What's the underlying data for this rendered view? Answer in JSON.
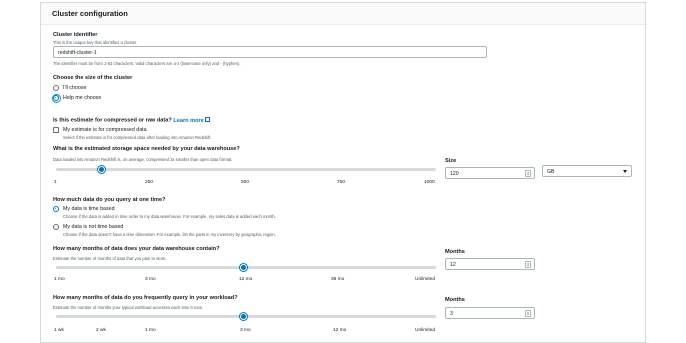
{
  "panel": {
    "title": "Cluster configuration"
  },
  "identifier": {
    "label": "Cluster identifier",
    "description": "This is the unique key that identifies a cluster.",
    "value": "redshift-cluster-1",
    "constraint": "The identifier must be from 1-63 characters. Valid characters are a-z (lowercase only) and - (hyphen)."
  },
  "size_choice": {
    "label": "Choose the size of the cluster",
    "options": [
      {
        "label": "I'll choose",
        "selected": false
      },
      {
        "label": "Help me choose",
        "selected": true
      }
    ]
  },
  "compressed": {
    "question": "Is this estimate for compressed or raw data?",
    "learn_more": "Learn more",
    "checkbox_label": "My estimate is for compressed data",
    "checkbox_desc": "Select if the estimate is for compressed data after loading into Amazon Redshift.",
    "checked": false
  },
  "storage": {
    "question": "What is the estimated storage space needed by your data warehouse?",
    "description": "Data loaded into Amazon Redshift is, on average, compressed 3x smaller than open data format.",
    "ticks": [
      "1",
      "250",
      "500",
      "750",
      "1000"
    ],
    "slider_value": 120,
    "slider_min": 1,
    "slider_max": 1000,
    "size_label": "Size",
    "size_value": "120",
    "unit_value": "GB"
  },
  "query_frequency": {
    "question": "How much data do you query at one time?",
    "options": [
      {
        "label": "My data is time based",
        "desc": "Choose if the data is added in time order to my data warehouse. For example, my sales data is added each month.",
        "selected": true
      },
      {
        "label": "My data is not time based",
        "desc": "Choose if the data doesn't have a time dimension. For example, list the parts in my inventory by geographic region.",
        "selected": false
      }
    ]
  },
  "months_contain": {
    "question": "How many months of data does your data warehouse contain?",
    "description": "Estimate the number of months of data that you plan to store.",
    "ticks": [
      "1 mo",
      "3 mo",
      "12 mo",
      "36 mo",
      "Unlimited"
    ],
    "slider_fraction": 0.5,
    "field_label": "Months",
    "field_value": "12"
  },
  "months_query": {
    "question": "How many months of data do you frequently query in your workload?",
    "description": "Estimate the number of months your typical workload accesses each time it runs.",
    "ticks": [
      "1 wk",
      "2 wk",
      "1 mo",
      "3 mo",
      "12 mo",
      "Unlimited"
    ],
    "slider_fraction": 0.5,
    "field_label": "Months",
    "field_value": "3"
  },
  "colors": {
    "accent": "#0073bb",
    "track": "#d5dbdb",
    "text": "#16191f",
    "muted": "#545b64"
  }
}
